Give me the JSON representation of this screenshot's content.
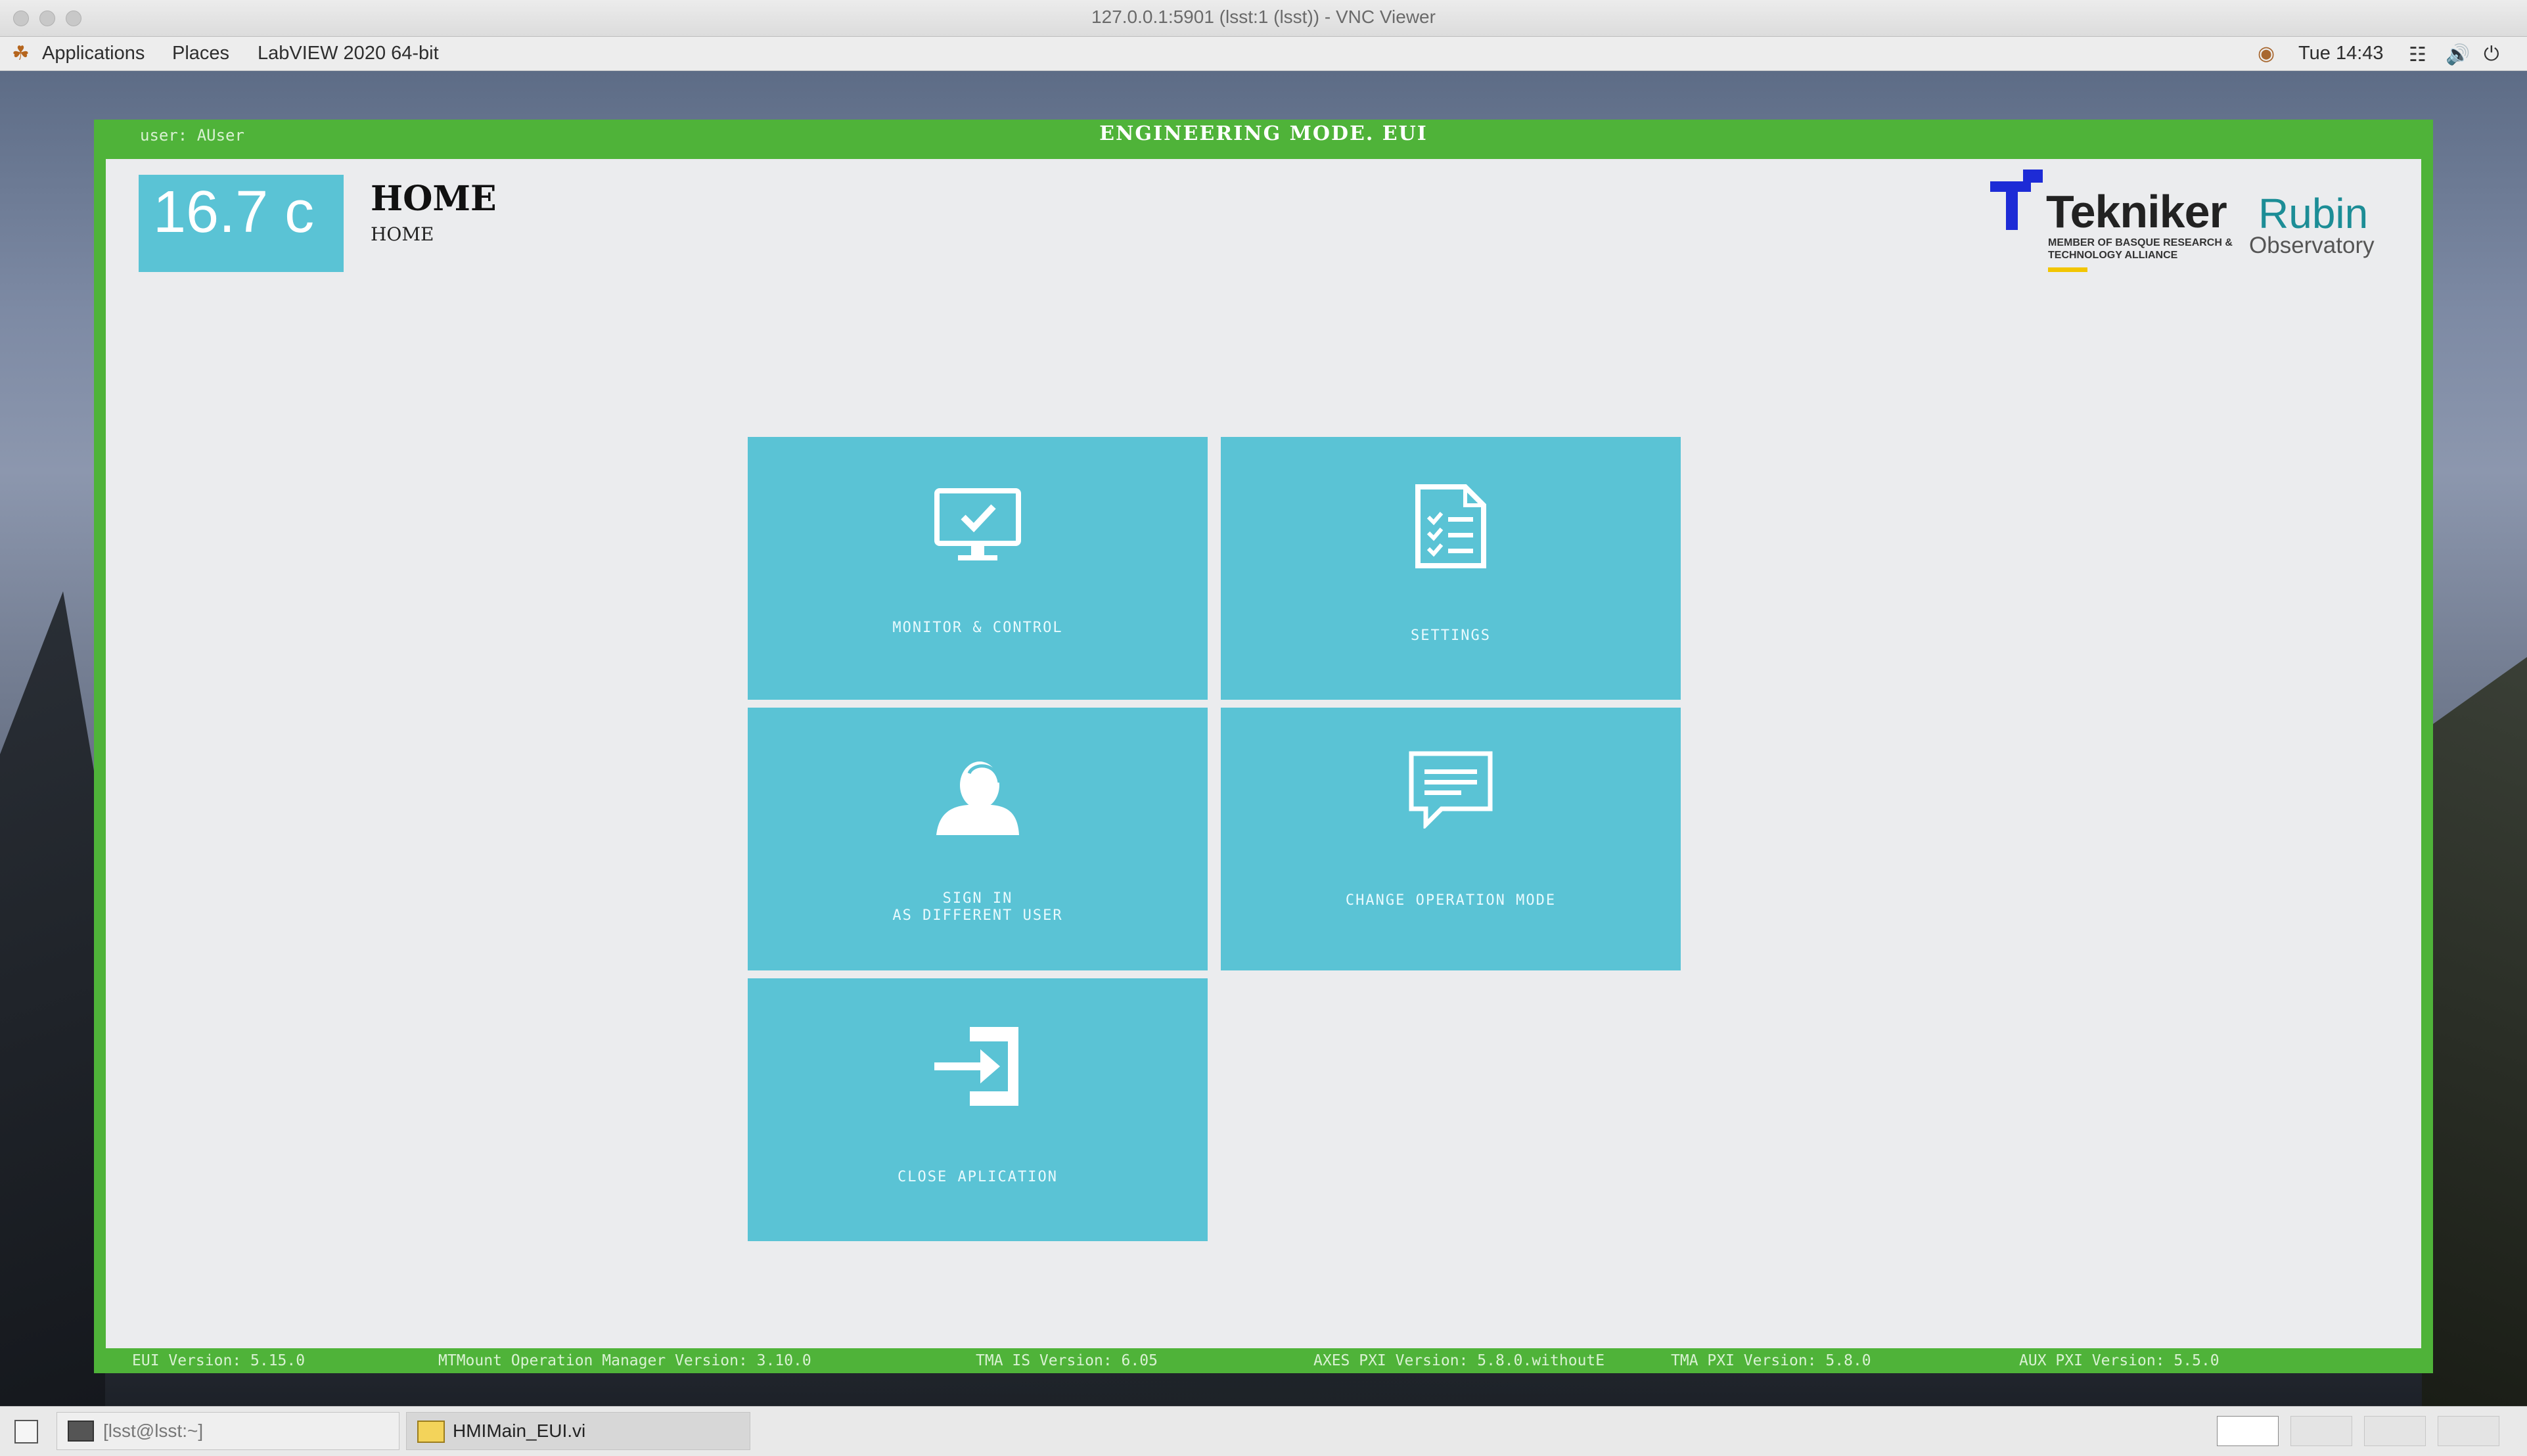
{
  "vnc": {
    "title": "127.0.0.1:5901 (lsst:1 (lsst)) - VNC Viewer"
  },
  "panel": {
    "applications": "Applications",
    "places": "Places",
    "app_name": "LabVIEW 2020 64-bit",
    "clock": "Tue 14:43",
    "icons": [
      "gnome-foot-icon",
      "status-icon",
      "network-icon",
      "volume-icon",
      "power-icon"
    ]
  },
  "eui": {
    "user": "user: AUser",
    "window_title": "ENGINEERING MODE. EUI",
    "temperature": "16.7 c",
    "page_title": "HOME",
    "breadcrumb": "HOME",
    "colors": {
      "frame": "#4fb339",
      "tile": "#5ac3d5",
      "content_bg": "#ebecee"
    },
    "logo": {
      "company": "Tekniker",
      "company_sub": "MEMBER OF BASQUE RESEARCH & TECHNOLOGY ALLIANCE",
      "observatory": "Rubin",
      "observatory_sub": "Observatory"
    },
    "tiles": [
      {
        "label": "MONITOR & CONTROL",
        "icon": "monitor-check-icon"
      },
      {
        "label": "SETTINGS",
        "icon": "checklist-document-icon"
      },
      {
        "label": "SIGN IN\nAS DIFFERENT USER",
        "icon": "user-icon"
      },
      {
        "label": "CHANGE OPERATION MODE",
        "icon": "chat-message-icon"
      },
      {
        "label": "CLOSE APLICATION",
        "icon": "sign-in-arrow-icon"
      }
    ],
    "footer": {
      "eui_version": "EUI Version: 5.15.0",
      "mtmount_version": "MTMount Operation Manager Version: 3.10.0",
      "tma_is_version": "TMA IS Version: 6.05",
      "axes_pxi_version": "AXES PXI Version: 5.8.0.withoutE",
      "tma_pxi_version": "TMA PXI Version: 5.8.0",
      "aux_pxi_version": "AUX PXI Version: 5.5.0"
    }
  },
  "taskbar": {
    "items": [
      {
        "label": "[lsst@lsst:~]",
        "icon": "terminal-icon"
      },
      {
        "label": "HMIMain_EUI.vi",
        "icon": "labview-vi-icon"
      }
    ]
  }
}
